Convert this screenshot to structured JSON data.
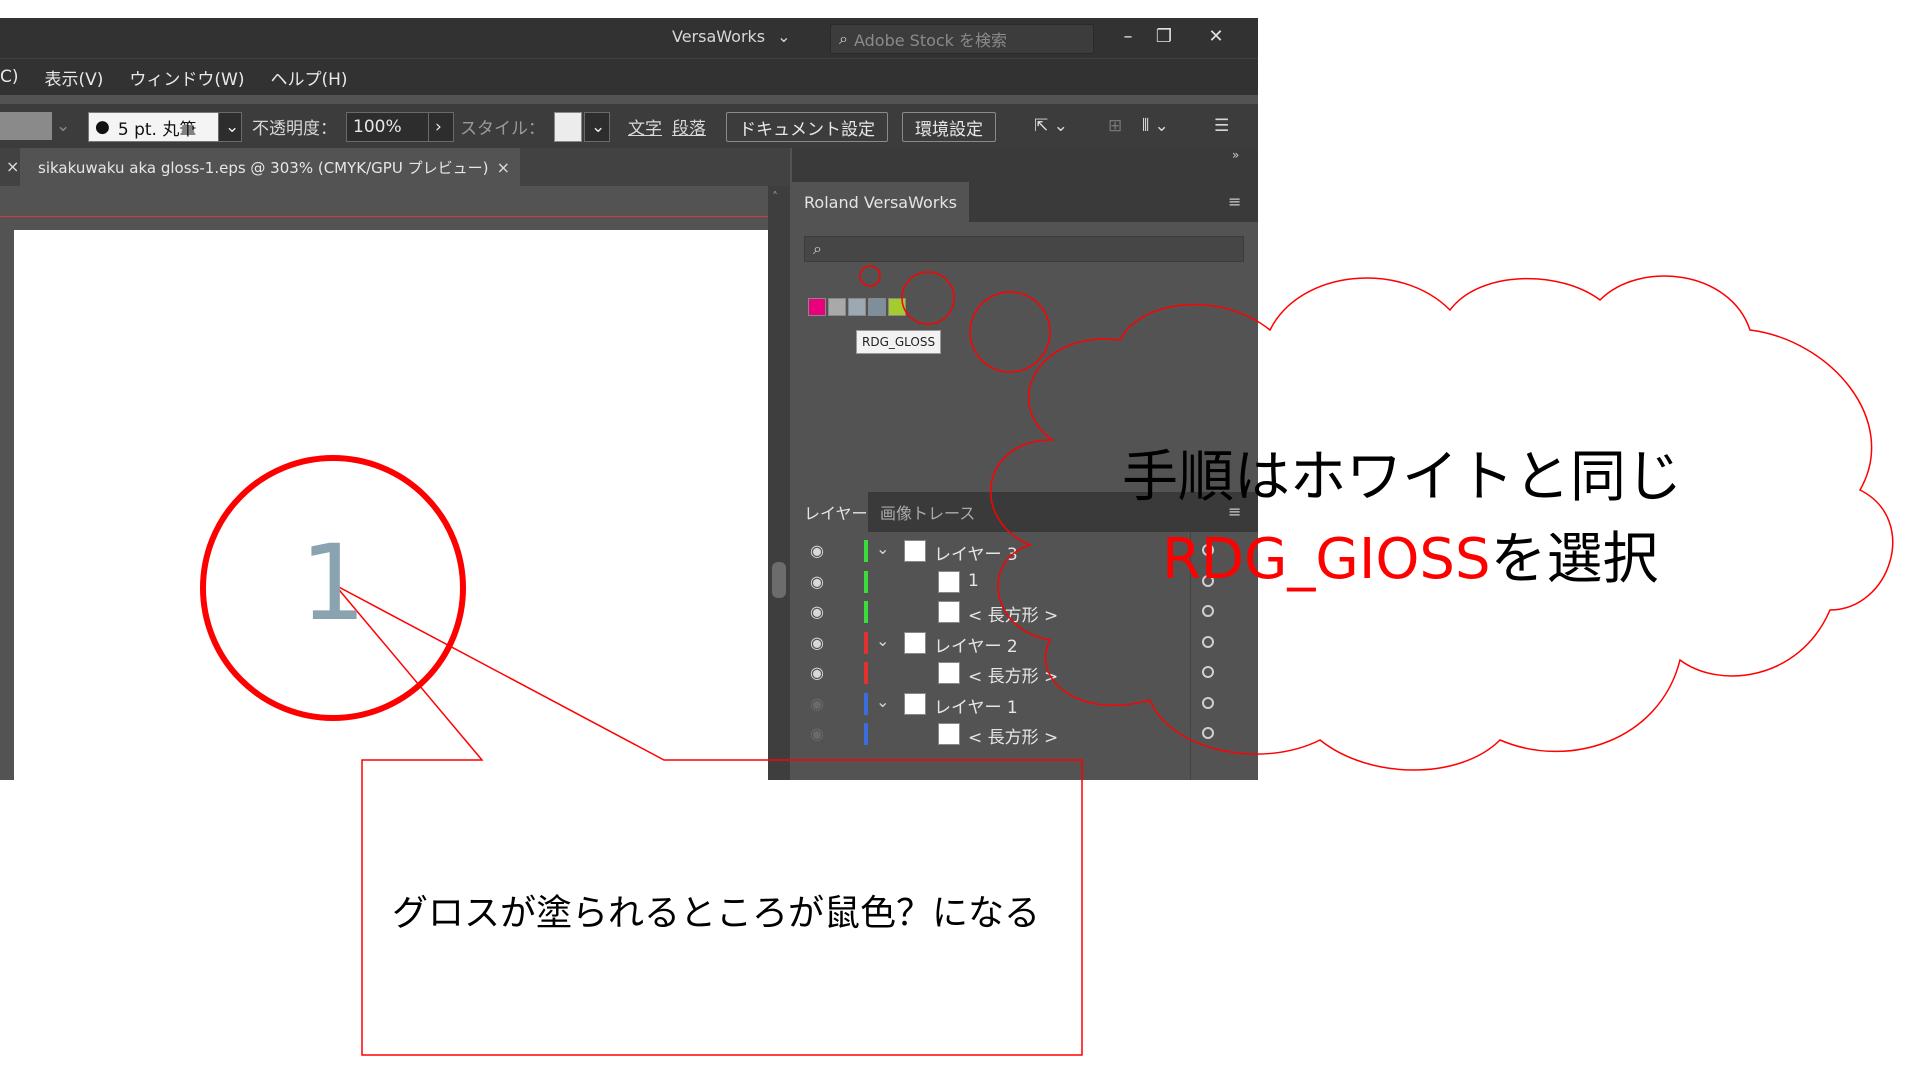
{
  "titlebar": {
    "workspace": "VersaWorks",
    "workspace_chevron_icon": "chevron-down-icon",
    "search_placeholder": "Adobe Stock を検索",
    "minimize": "–",
    "restore": "❐",
    "close": "✕"
  },
  "menu": {
    "partial": "C)",
    "view": "表示(V)",
    "window": "ウィンドウ(W)",
    "help": "ヘルプ(H)"
  },
  "controlbar": {
    "brush_size": "5 pt. 丸筆",
    "opacity_label": "不透明度：",
    "opacity_value": "100%",
    "style_label": "スタイル：",
    "character": "文字",
    "paragraph": "段落",
    "document_setup": "ドキュメント設定",
    "preferences": "環境設定"
  },
  "document": {
    "tab_title": "sikakuwaku aka gloss-1.eps @ 303% (CMYK/GPU プレビュー)",
    "close": "×",
    "artwork_text": "1"
  },
  "versaworks_panel": {
    "tab_label": "Roland VersaWorks",
    "menu_icon": "hamburger-icon",
    "tooltip": "RDG_GLOSS",
    "swatch_colors": [
      "#e8007c",
      "#a9a9a9",
      "#9aa9b4",
      "#7e8f9c",
      "#a4cc2e"
    ]
  },
  "layers_panel": {
    "tab_layers": "レイヤー",
    "tab_trace": "画像トレース",
    "rows": [
      {
        "name": "レイヤー 3",
        "visible": true,
        "color": "#3ddc3d",
        "expand": true,
        "indent": 0
      },
      {
        "name": "1",
        "visible": true,
        "color": "#3ddc3d",
        "expand": false,
        "indent": 1
      },
      {
        "name": "< 長方形 >",
        "visible": true,
        "color": "#3ddc3d",
        "expand": false,
        "indent": 1
      },
      {
        "name": "レイヤー 2",
        "visible": true,
        "color": "#e53030",
        "expand": true,
        "indent": 0
      },
      {
        "name": "< 長方形 >",
        "visible": true,
        "color": "#e53030",
        "expand": false,
        "indent": 1
      },
      {
        "name": "レイヤー 1",
        "visible": false,
        "color": "#3a6ee0",
        "expand": true,
        "indent": 0
      },
      {
        "name": "< 長方形 >",
        "visible": false,
        "color": "#3a6ee0",
        "expand": false,
        "indent": 1
      }
    ]
  },
  "annotations": {
    "cloud_line1": "手順はホワイトと同じ",
    "cloud_line2_red": "RDG_GIOSS",
    "cloud_line2_black": "を選択",
    "callout": "グロスが塗られるところが鼠色？になる",
    "accent_color": "#ff0000"
  }
}
